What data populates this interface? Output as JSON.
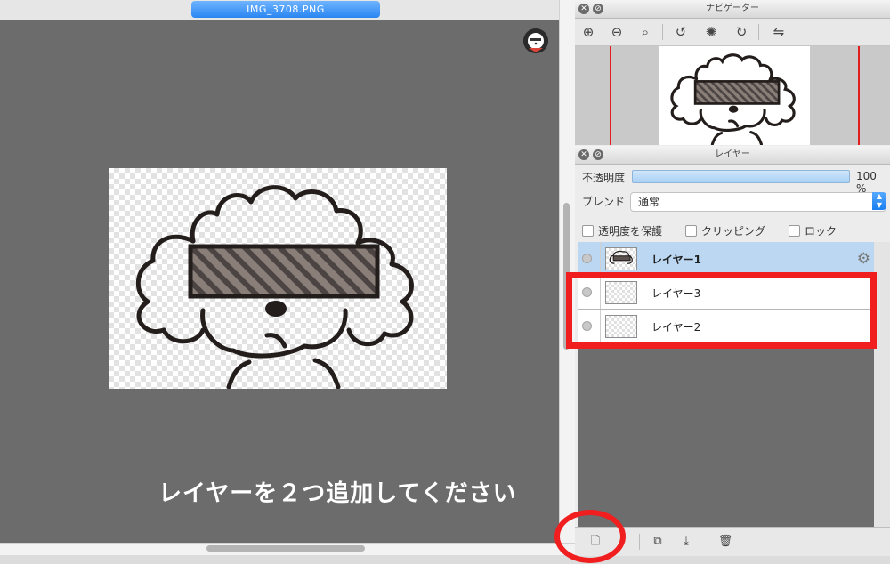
{
  "document": {
    "tab_title": "IMG_3708.PNG"
  },
  "instruction_text": "レイヤーを２つ追加してください",
  "navigator": {
    "title": "ナビゲーター",
    "tools": [
      "zoom-in-icon",
      "zoom-out-icon",
      "zoom-fit-icon",
      "rotate-left-icon",
      "rotate-reset-icon",
      "rotate-right-icon",
      "flip-icon"
    ]
  },
  "layer_panel": {
    "title": "レイヤー",
    "opacity_label": "不透明度",
    "opacity_value": "100 %",
    "opacity_fraction": 1.0,
    "blend_label": "ブレンド",
    "blend_value": "通常",
    "checkboxes": {
      "protect_alpha": "透明度を保護",
      "clipping": "クリッピング",
      "lock": "ロック"
    },
    "layers": [
      {
        "name": "レイヤー1",
        "selected": true
      },
      {
        "name": "レイヤー3",
        "selected": false
      },
      {
        "name": "レイヤー2",
        "selected": false
      }
    ]
  },
  "colors": {
    "accent_blue": "#2a86f2",
    "highlight_red": "#f01e1e",
    "canvas_gray": "#6c6c6c"
  }
}
